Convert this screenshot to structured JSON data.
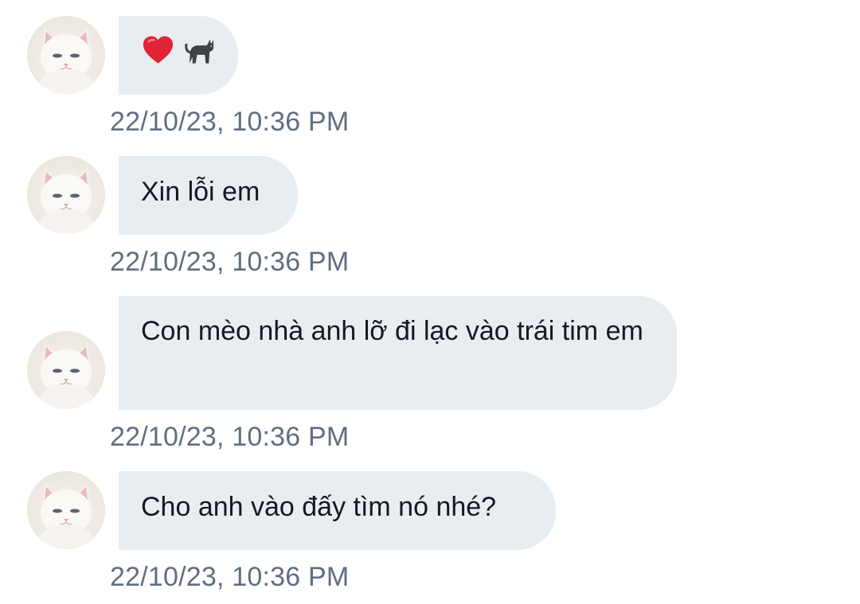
{
  "messages": [
    {
      "sender_avatar": "white-cat-avatar",
      "type": "emoji",
      "emoji": [
        {
          "name": "heart-emoji",
          "glyph": "❤️"
        },
        {
          "name": "black-cat-emoji",
          "glyph": "🐈‍⬛"
        }
      ],
      "timestamp": "22/10/23, 10:36 PM"
    },
    {
      "sender_avatar": "white-cat-avatar",
      "type": "text",
      "text": "Xin lỗi em",
      "timestamp": "22/10/23, 10:36 PM"
    },
    {
      "sender_avatar": "white-cat-avatar",
      "type": "text",
      "text": "Con mèo nhà anh lỡ đi lạc vào trái tim em",
      "timestamp": "22/10/23, 10:36 PM"
    },
    {
      "sender_avatar": "white-cat-avatar",
      "type": "text",
      "text": "Cho anh vào đấy tìm nó nhé?",
      "timestamp": "22/10/23, 10:36 PM"
    }
  ],
  "colors": {
    "bubble_background": "#e8edf2",
    "message_text": "#141a20",
    "timestamp_text": "#5f6f82",
    "page_background": "#ffffff",
    "heart": "#e02435"
  }
}
